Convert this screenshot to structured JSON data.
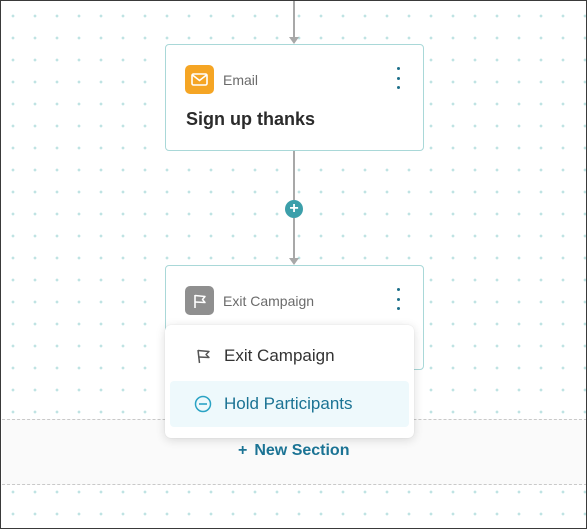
{
  "canvas": {
    "colors": {
      "accent": "#1b7394",
      "connector": "#a8a8a8",
      "card_border": "#a9d8d8",
      "dot_grid": "#bfe3e3",
      "email_badge": "#f5a524",
      "exit_badge": "#8f8f8f",
      "add_step": "#3c9faa"
    }
  },
  "email_step": {
    "type_label": "Email",
    "title": "Sign up thanks",
    "icon": "envelope-icon",
    "menu_icon": "kebab-menu-icon"
  },
  "add_step": {
    "symbol": "+",
    "icon": "plus-icon"
  },
  "exit_step": {
    "type_label": "Exit Campaign",
    "icon": "flag-icon",
    "menu_icon": "kebab-menu-icon"
  },
  "exit_menu": {
    "items": [
      {
        "label": "Exit Campaign",
        "icon": "flag-outline-icon",
        "selected": false
      },
      {
        "label": "Hold Participants",
        "icon": "minus-circle-icon",
        "selected": true
      }
    ]
  },
  "new_section": {
    "symbol": "+",
    "label": "New Section"
  }
}
